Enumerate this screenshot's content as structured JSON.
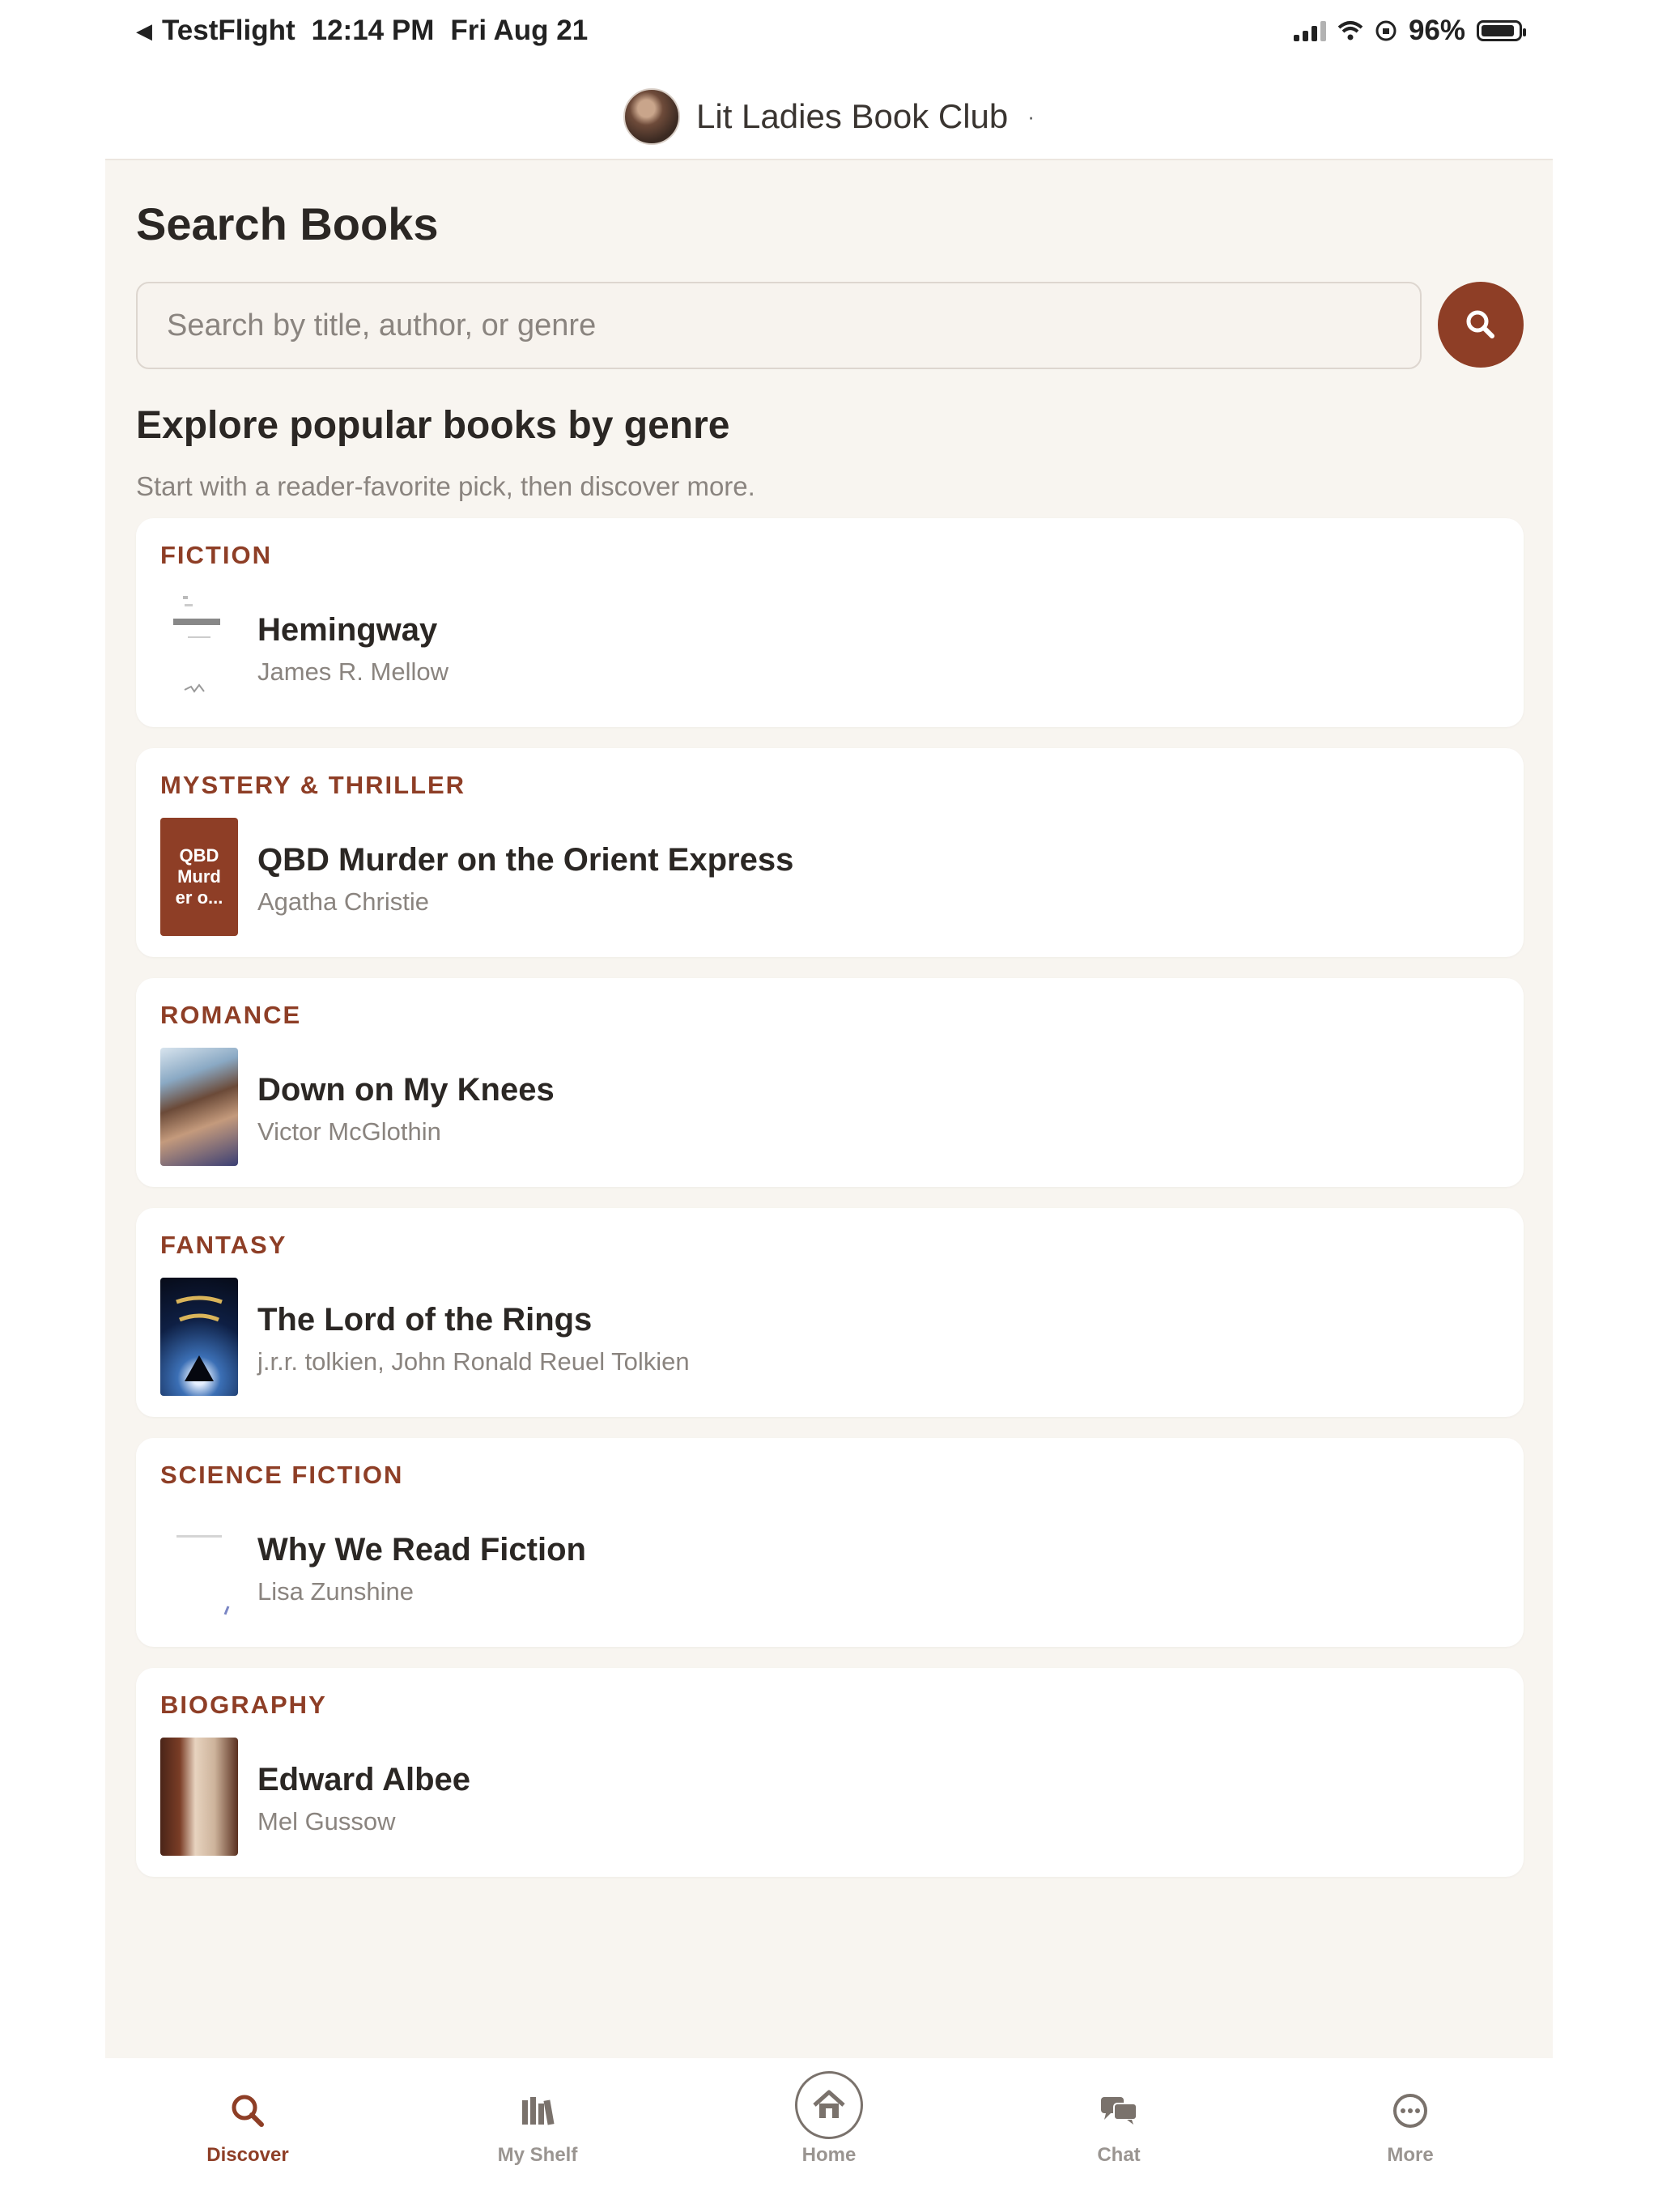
{
  "status_bar": {
    "back_label": "TestFlight",
    "time": "12:14 PM",
    "date": "Fri Aug 21",
    "battery": "96%"
  },
  "header": {
    "club_name": "Lit Ladies Book Club",
    "caret": "·"
  },
  "page": {
    "title": "Search Books",
    "search_placeholder": "Search by title, author, or genre",
    "section_title": "Explore popular books by genre",
    "section_subtitle": "Start with a reader-favorite pick, then discover more."
  },
  "books": [
    {
      "genre": "FICTION",
      "title": "Hemingway",
      "author": "James R. Mellow",
      "cover": "blank"
    },
    {
      "genre": "MYSTERY & THRILLER",
      "title": "QBD Murder on the Orient Express",
      "author": "Agatha Christie",
      "cover": "text",
      "cover_text": "QBD Murd er o..."
    },
    {
      "genre": "ROMANCE",
      "title": "Down on My Knees",
      "author": "Victor McGlothin",
      "cover": "image"
    },
    {
      "genre": "FANTASY",
      "title": "The Lord of the Rings",
      "author": "j.r.r. tolkien, John Ronald Reuel Tolkien",
      "cover": "image"
    },
    {
      "genre": "SCIENCE FICTION",
      "title": "Why We Read Fiction",
      "author": "Lisa Zunshine",
      "cover": "blank"
    },
    {
      "genre": "BIOGRAPHY",
      "title": "Edward Albee",
      "author": "Mel Gussow",
      "cover": "image"
    }
  ],
  "tabs": [
    {
      "label": "Discover",
      "icon": "search-icon",
      "active": true
    },
    {
      "label": "My Shelf",
      "icon": "bookshelf-icon",
      "active": false
    },
    {
      "label": "Home",
      "icon": "home-icon",
      "active": false
    },
    {
      "label": "Chat",
      "icon": "chat-bubbles-icon",
      "active": false
    },
    {
      "label": "More",
      "icon": "more-icon",
      "active": false
    }
  ],
  "colors": {
    "accent": "#8e3e26",
    "background": "#f8f5f0",
    "card": "#ffffff",
    "muted_text": "#8a847f"
  }
}
